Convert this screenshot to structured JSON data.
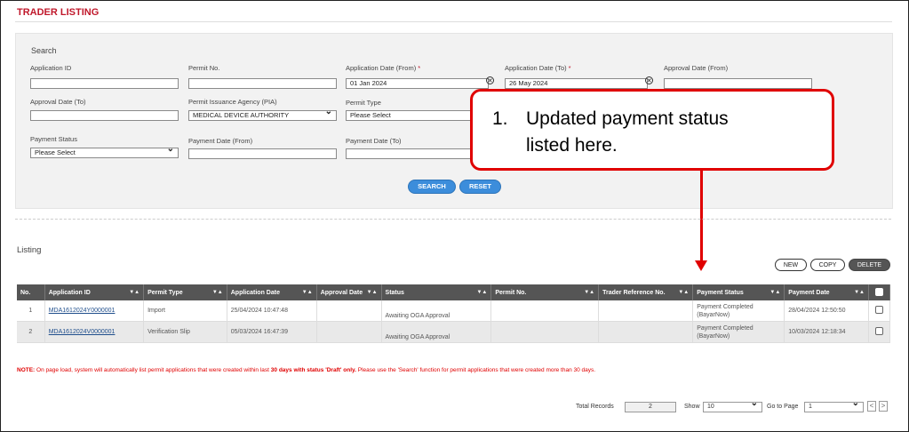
{
  "page": {
    "title": "TRADER LISTING"
  },
  "search": {
    "title": "Search",
    "application_id": {
      "label": "Application ID",
      "value": ""
    },
    "permit_no": {
      "label": "Permit No.",
      "value": ""
    },
    "app_date_from": {
      "label": "Application Date (From)",
      "required_mark": "*",
      "value": "01 Jan 2024"
    },
    "app_date_to": {
      "label": "Application Date (To)",
      "required_mark": "*",
      "value": "26 May 2024"
    },
    "approval_date_from": {
      "label": "Approval Date (From)",
      "value": ""
    },
    "approval_date_to": {
      "label": "Approval Date (To)",
      "value": ""
    },
    "pia": {
      "label": "Permit Issuance Agency (PIA)",
      "value": "MEDICAL DEVICE AUTHORITY"
    },
    "permit_type": {
      "label": "Permit Type",
      "value": "Please Select"
    },
    "payment_status": {
      "label": "Payment Status",
      "value": "Please Select"
    },
    "payment_date_from": {
      "label": "Payment Date (From)",
      "value": ""
    },
    "payment_date_to": {
      "label": "Payment Date (To)",
      "value": ""
    },
    "search_button": "SEARCH",
    "reset_button": "RESET"
  },
  "callout": {
    "number": "1.",
    "line1": "Updated payment status",
    "line2": "listed here."
  },
  "listing": {
    "title": "Listing",
    "new_button": "NEW",
    "copy_button": "COPY",
    "delete_button": "DELETE",
    "sort_icon": "▼▲",
    "columns": [
      "No.",
      "Application ID",
      "Permit Type",
      "Application Date",
      "Approval Date",
      "Status",
      "Permit No.",
      "Trader Reference No.",
      "Payment Status",
      "Payment Date"
    ],
    "rows": [
      {
        "no": "1",
        "application_id": "MDA1612024Y0000001",
        "permit_type": "Import",
        "application_date": "25/04/2024 10:47:48",
        "approval_date": "",
        "status": "Awaiting OGA Approval",
        "permit_no": "",
        "trader_ref": "",
        "payment_status": "Payment Completed (BayarNow)",
        "payment_date": "28/04/2024 12:50:50"
      },
      {
        "no": "2",
        "application_id": "MDA1612024V0000001",
        "permit_type": "Verification Slip",
        "application_date": "05/03/2024 16:47:39",
        "approval_date": "",
        "status": "Awaiting OGA Approval",
        "permit_no": "",
        "trader_ref": "",
        "payment_status": "Payment Completed (BayarNow)",
        "payment_date": "10/03/2024 12:18:34"
      }
    ]
  },
  "note": {
    "prefix": "NOTE:",
    "text_a": " On page load, system will automatically list permit applications that were created within last ",
    "bold": "30 days with status 'Draft' only.",
    "text_b": " Please use the 'Search' function for permit applications that were created more than 30 days."
  },
  "footer": {
    "total_label": "Total Records",
    "total_value": "2",
    "show_label": "Show",
    "show_value": "10",
    "goto_label": "Go to Page",
    "goto_value": "1",
    "prev_icon": "<",
    "next_icon": ">"
  },
  "colors": {
    "accent_red": "#c0182b",
    "callout_red": "#e00000",
    "button_blue": "#3c8ddb",
    "header_gray": "#555555"
  }
}
